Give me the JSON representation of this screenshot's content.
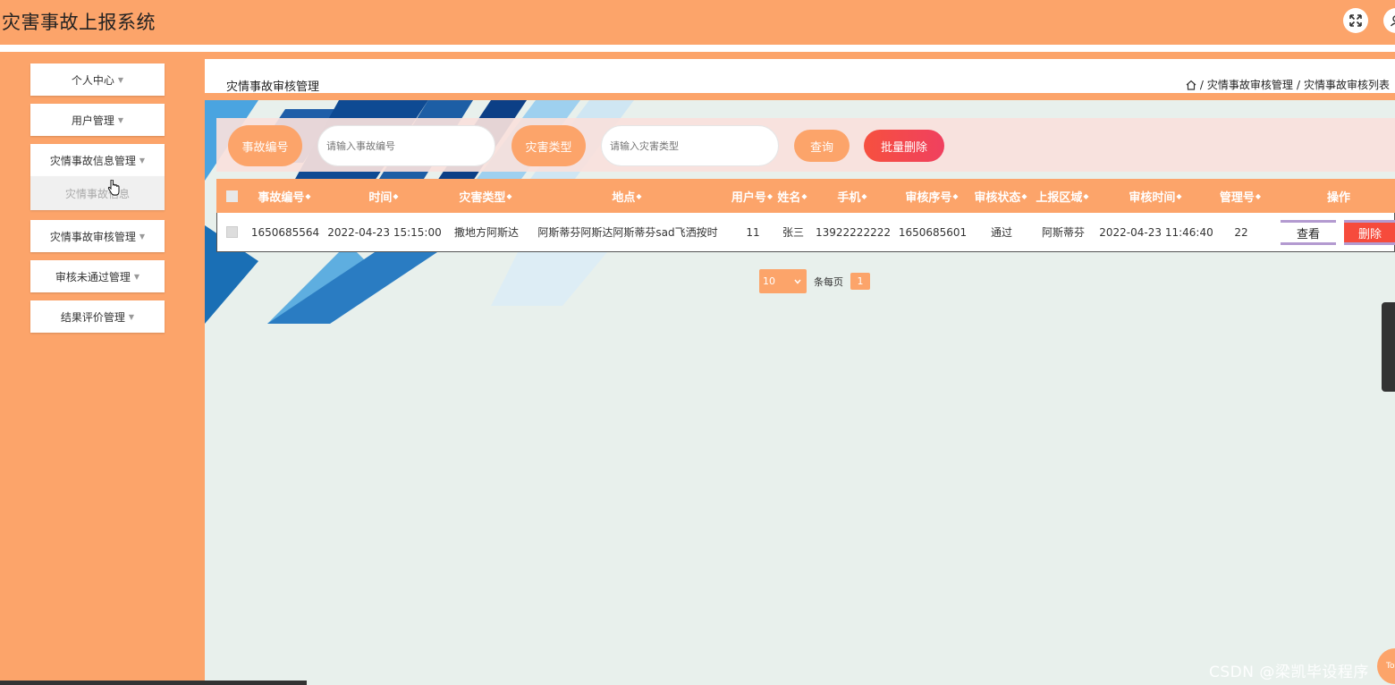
{
  "app": {
    "title": "灾害事故上报系统"
  },
  "header": {
    "fullscreen_icon": "expand-icon",
    "user_icon": "user-icon"
  },
  "sidebar": {
    "items": [
      {
        "label": "个人中心"
      },
      {
        "label": "用户管理"
      },
      {
        "label": "灾情事故信息管理"
      },
      {
        "label": "灾情事故审核管理"
      },
      {
        "label": "审核未通过管理"
      },
      {
        "label": "结果评价管理"
      }
    ],
    "submenu_label": "灾情事故信息"
  },
  "page": {
    "title": "灾情事故审核管理",
    "breadcrumb": [
      "灾情事故审核管理",
      "灾情事故审核列表"
    ]
  },
  "search": {
    "field1_label": "事故编号",
    "field1_placeholder": "请输入事故编号",
    "field2_label": "灾害类型",
    "field2_placeholder": "请输入灾害类型",
    "query_label": "查询",
    "batch_delete_label": "批量删除"
  },
  "table": {
    "columns": [
      "事故编号",
      "时间",
      "灾害类型",
      "地点",
      "用户号",
      "姓名",
      "手机",
      "审核序号",
      "审核状态",
      "上报区域",
      "审核时间",
      "管理号",
      "操作"
    ],
    "rows": [
      [
        "1650685564",
        "2022-04-23 15:15:00",
        "撒地方阿斯达",
        "阿斯蒂芬阿斯达阿斯蒂芬sad飞洒按时",
        "11",
        "张三",
        "13922222222",
        "1650685601",
        "通过",
        "阿斯蒂芬",
        "2022-04-23 11:46:40",
        "22"
      ]
    ],
    "view_label": "查看",
    "delete_label": "删除"
  },
  "pagination": {
    "page_size": "10",
    "per_page_label": "条每页",
    "current_page": "1"
  },
  "watermark": "CSDN @梁凯毕设程序",
  "top_button_label": "To",
  "colors": {
    "accent": "#fca46a",
    "danger": "#f64b3c",
    "background": "#e8f0ec"
  }
}
